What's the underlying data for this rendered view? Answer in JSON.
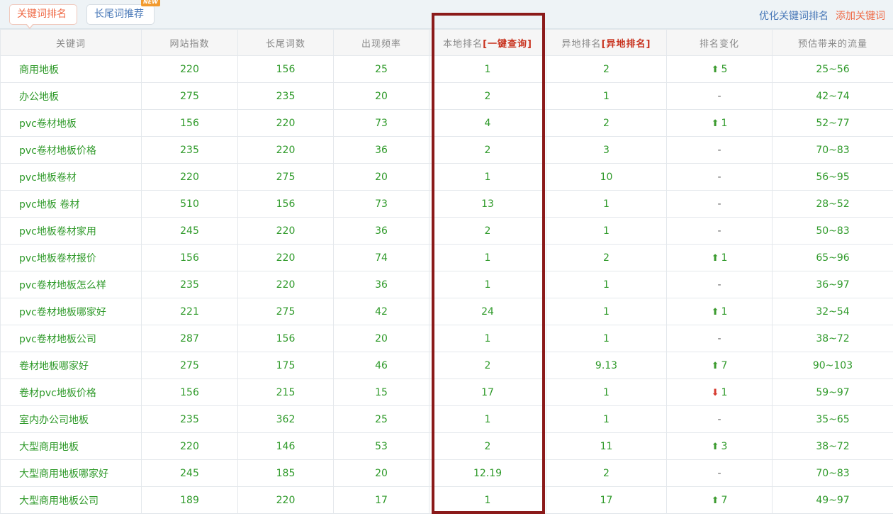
{
  "tabs": {
    "active_label": "关键词排名",
    "longtail_label": "长尾词推荐",
    "new_badge": "NEW"
  },
  "links": {
    "optimize": "优化关键词排名",
    "add": "添加关键词"
  },
  "table": {
    "headers": {
      "keyword": "关键词",
      "site_index": "网站指数",
      "longtail_count": "长尾词数",
      "frequency": "出现频率",
      "local_rank": "本地排名",
      "local_rank_link": "[一键查询]",
      "remote_rank": "异地排名",
      "remote_rank_link": "[异地排名]",
      "rank_change": "排名变化",
      "traffic": "预估带来的流量"
    },
    "rows": [
      {
        "keyword": "商用地板",
        "index": "220",
        "longtail": "156",
        "freq": "25",
        "local": "1",
        "remote": "2",
        "change_dir": "up",
        "change_val": "5",
        "traffic": "25~56"
      },
      {
        "keyword": "办公地板",
        "index": "275",
        "longtail": "235",
        "freq": "20",
        "local": "2",
        "remote": "1",
        "change_dir": "none",
        "change_val": "-",
        "traffic": "42~74"
      },
      {
        "keyword": "pvc卷材地板",
        "index": "156",
        "longtail": "220",
        "freq": "73",
        "local": "4",
        "remote": "2",
        "change_dir": "up",
        "change_val": "1",
        "traffic": "52~77"
      },
      {
        "keyword": "pvc卷材地板价格",
        "index": "235",
        "longtail": "220",
        "freq": "36",
        "local": "2",
        "remote": "3",
        "change_dir": "none",
        "change_val": "-",
        "traffic": "70~83"
      },
      {
        "keyword": "pvc地板卷材",
        "index": "220",
        "longtail": "275",
        "freq": "20",
        "local": "1",
        "remote": "10",
        "change_dir": "none",
        "change_val": "-",
        "traffic": "56~95"
      },
      {
        "keyword": "pvc地板 卷材",
        "index": "510",
        "longtail": "156",
        "freq": "73",
        "local": "13",
        "remote": "1",
        "change_dir": "none",
        "change_val": "-",
        "traffic": "28~52"
      },
      {
        "keyword": "pvc地板卷材家用",
        "index": "245",
        "longtail": "220",
        "freq": "36",
        "local": "2",
        "remote": "1",
        "change_dir": "none",
        "change_val": "-",
        "traffic": "50~83"
      },
      {
        "keyword": "pvc地板卷材报价",
        "index": "156",
        "longtail": "220",
        "freq": "74",
        "local": "1",
        "remote": "2",
        "change_dir": "up",
        "change_val": "1",
        "traffic": "65~96"
      },
      {
        "keyword": "pvc卷材地板怎么样",
        "index": "235",
        "longtail": "220",
        "freq": "36",
        "local": "1",
        "remote": "1",
        "change_dir": "none",
        "change_val": "-",
        "traffic": "36~97"
      },
      {
        "keyword": "pvc卷材地板哪家好",
        "index": "221",
        "longtail": "275",
        "freq": "42",
        "local": "24",
        "remote": "1",
        "change_dir": "up",
        "change_val": "1",
        "traffic": "32~54"
      },
      {
        "keyword": "pvc卷材地板公司",
        "index": "287",
        "longtail": "156",
        "freq": "20",
        "local": "1",
        "remote": "1",
        "change_dir": "none",
        "change_val": "-",
        "traffic": "38~72"
      },
      {
        "keyword": "卷材地板哪家好",
        "index": "275",
        "longtail": "175",
        "freq": "46",
        "local": "2",
        "remote": "9.13",
        "change_dir": "up",
        "change_val": "7",
        "traffic": "90~103"
      },
      {
        "keyword": "卷材pvc地板价格",
        "index": "156",
        "longtail": "215",
        "freq": "15",
        "local": "17",
        "remote": "1",
        "change_dir": "down",
        "change_val": "1",
        "traffic": "59~97"
      },
      {
        "keyword": "室内办公司地板",
        "index": "235",
        "longtail": "362",
        "freq": "25",
        "local": "1",
        "remote": "1",
        "change_dir": "none",
        "change_val": "-",
        "traffic": "35~65"
      },
      {
        "keyword": "大型商用地板",
        "index": "220",
        "longtail": "146",
        "freq": "53",
        "local": "2",
        "remote": "11",
        "change_dir": "up",
        "change_val": "3",
        "traffic": "38~72"
      },
      {
        "keyword": "大型商用地板哪家好",
        "index": "245",
        "longtail": "185",
        "freq": "20",
        "local": "12.19",
        "remote": "2",
        "change_dir": "none",
        "change_val": "-",
        "traffic": "70~83"
      },
      {
        "keyword": "大型商用地板公司",
        "index": "189",
        "longtail": "220",
        "freq": "17",
        "local": "1",
        "remote": "17",
        "change_dir": "up",
        "change_val": "7",
        "traffic": "49~97"
      }
    ]
  },
  "colors": {
    "accent_orange": "#ef6a46",
    "link_blue": "#4a79b8",
    "data_green": "#2f9a2a",
    "highlight_frame": "#8b1a1a",
    "rank_up": "#3b9b2e",
    "rank_down": "#d63b2f"
  },
  "icons": {
    "rank_up": "arrow-up-icon",
    "rank_down": "arrow-down-icon"
  }
}
